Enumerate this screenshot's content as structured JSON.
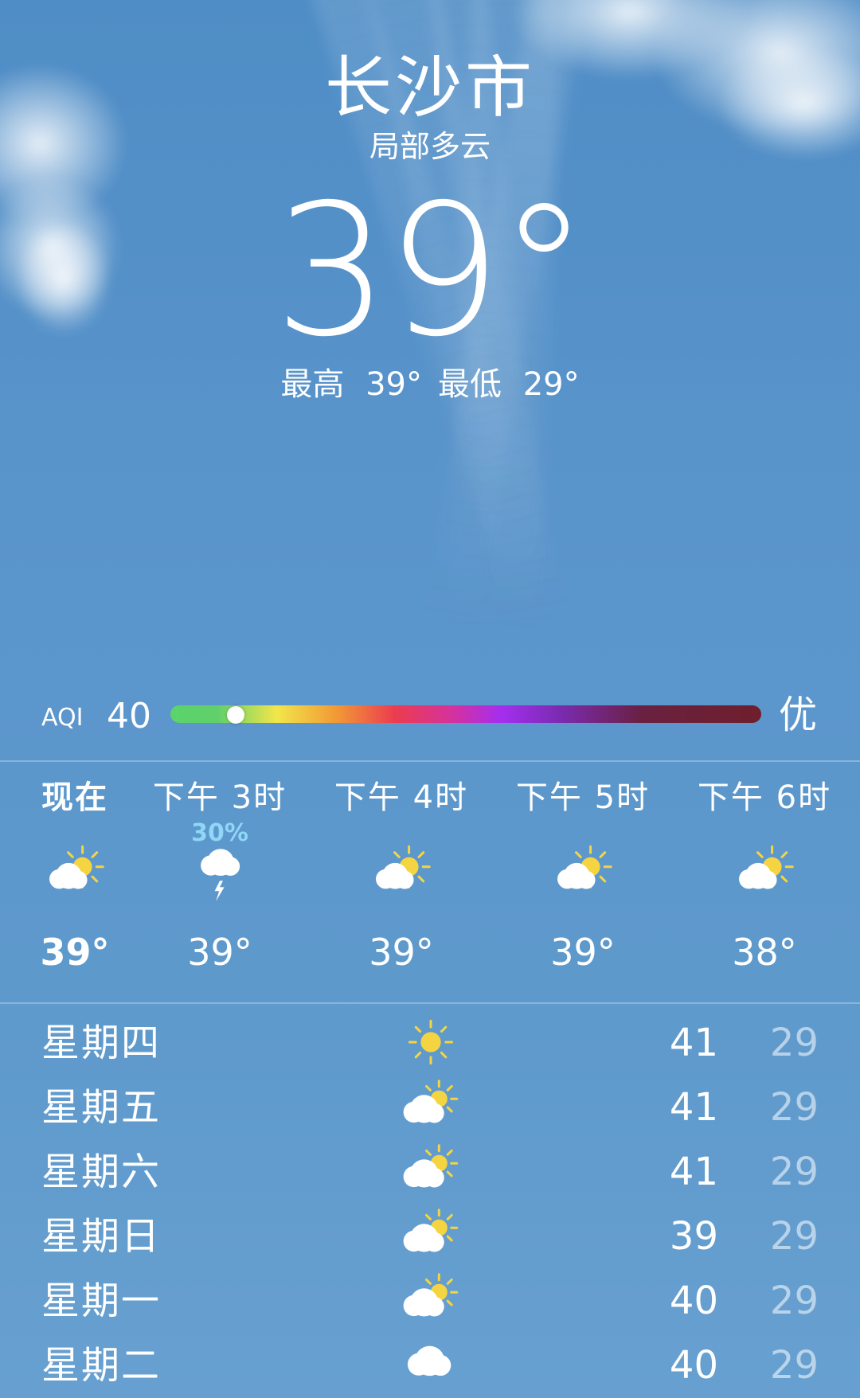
{
  "location": {
    "city": "长沙市",
    "condition": "局部多云",
    "temperature": "39°",
    "high": "最高 39°",
    "low": "最低 29°"
  },
  "aqi": {
    "label": "AQI",
    "value": "40",
    "level": "优",
    "position_fraction": 0.11
  },
  "hourly": [
    {
      "label": "现在",
      "pop": "",
      "icon": "partly-cloudy-day-icon",
      "temp": "39°"
    },
    {
      "label": "下午 3时",
      "pop": "30%",
      "icon": "thunderstorm-icon",
      "temp": "39°"
    },
    {
      "label": "下午 4时",
      "pop": "",
      "icon": "partly-cloudy-day-icon",
      "temp": "39°"
    },
    {
      "label": "下午 5时",
      "pop": "",
      "icon": "partly-cloudy-day-icon",
      "temp": "39°"
    },
    {
      "label": "下午 6时",
      "pop": "",
      "icon": "partly-cloudy-day-icon",
      "temp": "38°"
    }
  ],
  "daily": [
    {
      "day": "星期四",
      "icon": "sun-icon",
      "high": "41",
      "low": "29"
    },
    {
      "day": "星期五",
      "icon": "partly-cloudy-day-icon",
      "high": "41",
      "low": "29"
    },
    {
      "day": "星期六",
      "icon": "partly-cloudy-day-icon",
      "high": "41",
      "low": "29"
    },
    {
      "day": "星期日",
      "icon": "partly-cloudy-day-icon",
      "high": "39",
      "low": "29"
    },
    {
      "day": "星期一",
      "icon": "partly-cloudy-day-icon",
      "high": "40",
      "low": "29"
    },
    {
      "day": "星期二",
      "icon": "cloud-icon",
      "high": "40",
      "low": "29"
    }
  ],
  "colors": {
    "sun": "#f5d442",
    "precip": "#8fd6f7"
  }
}
